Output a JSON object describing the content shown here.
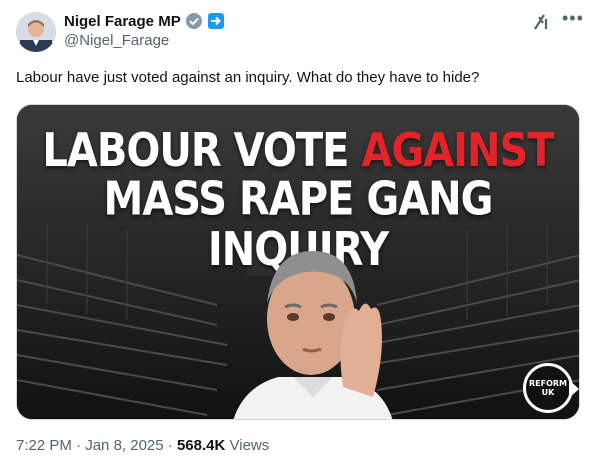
{
  "author": {
    "display_name": "Nigel Farage MP",
    "handle": "@Nigel_Farage",
    "badges": [
      "verified-badge",
      "affiliation-badge"
    ]
  },
  "tweet": {
    "text": "Labour have just voted against an inquiry. What do they have to hide?"
  },
  "media": {
    "headline_line1_part1": "LABOUR VOTE ",
    "headline_line1_part2": "AGAINST",
    "headline_line2": "MASS RAPE GANG INQUIRY",
    "logo_top": "REFORM",
    "logo_bottom": "UK",
    "accent_color": "#e0242a"
  },
  "meta": {
    "time": "7:22 PM",
    "separator1": " · ",
    "date": "Jan 8, 2025",
    "separator2": " · ",
    "views_count": "568.4K",
    "views_label": " Views"
  },
  "icons": {
    "grok": "grok-icon",
    "more": "more-options-icon"
  }
}
